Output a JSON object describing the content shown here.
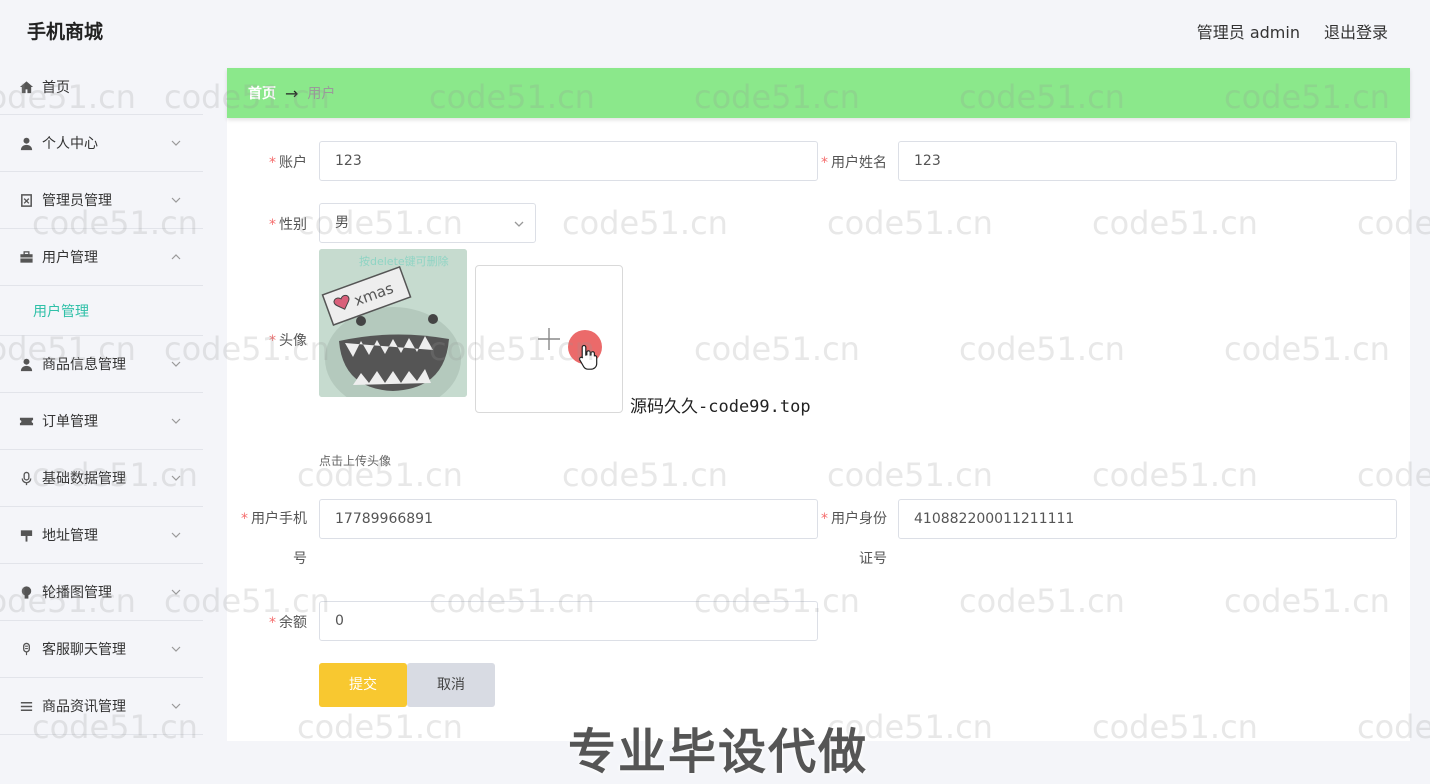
{
  "header": {
    "brand": "手机商城",
    "admin_label": "管理员 admin",
    "logout_label": "退出登录"
  },
  "sidebar": {
    "items": [
      {
        "label": "首页",
        "icon": "home-icon"
      },
      {
        "label": "个人中心",
        "icon": "user-icon"
      },
      {
        "label": "管理员管理",
        "icon": "admin-icon"
      },
      {
        "label": "用户管理",
        "icon": "briefcase-icon"
      },
      {
        "label": "商品信息管理",
        "icon": "user-icon"
      },
      {
        "label": "订单管理",
        "icon": "ticket-icon"
      },
      {
        "label": "基础数据管理",
        "icon": "microphone-icon"
      },
      {
        "label": "地址管理",
        "icon": "signpost-icon"
      },
      {
        "label": "轮播图管理",
        "icon": "bulb-icon"
      },
      {
        "label": "客服聊天管理",
        "icon": "mic-icon"
      },
      {
        "label": "商品资讯管理",
        "icon": "list-icon"
      }
    ],
    "sub_item": "用户管理"
  },
  "breadcrumb": {
    "home": "首页",
    "arrow": "→",
    "current": "用户"
  },
  "form": {
    "account": {
      "label": "账户",
      "value": "123"
    },
    "name": {
      "label": "用户姓名",
      "value": "123"
    },
    "gender": {
      "label": "性别",
      "value": "男"
    },
    "avatar": {
      "label": "头像",
      "hint": "点击上传头像",
      "image_caption": "按delete键可删除",
      "image_text": "xmas"
    },
    "phone": {
      "label_line1": "用户手机",
      "label_line2": "号",
      "value": "17789966891"
    },
    "idcard": {
      "label_line1": "用户身份",
      "label_line2": "证号",
      "value": "410882200011211111"
    },
    "balance": {
      "label": "余额",
      "value": "0"
    },
    "required_mark": "*",
    "submit_label": "提交",
    "cancel_label": "取消"
  },
  "overlay": {
    "code_text": "源码久久-code99.top",
    "banner": "专业毕设代做",
    "watermark": "code51.cn"
  },
  "colors": {
    "breadcrumb_bg": "#8be88b",
    "submit_bg": "#f8c830",
    "cancel_bg": "#d8dbe3",
    "active_sub": "#2fc0a8",
    "required": "#f56c6c"
  }
}
